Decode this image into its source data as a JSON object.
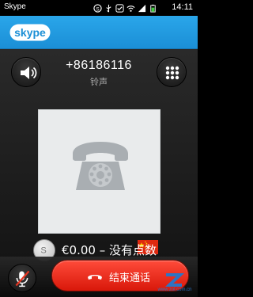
{
  "status_bar": {
    "app_name": "Skype",
    "time": "14:11",
    "icons": [
      "skype-icon",
      "usb-icon",
      "check-icon",
      "wifi-icon",
      "signal-icon",
      "battery-icon"
    ]
  },
  "header": {
    "logo_text": "skype"
  },
  "call": {
    "phone_number": "+86186116",
    "status": "铃声",
    "country_flag": "china-flag"
  },
  "credit": {
    "text": "€0.00 – 没有点数"
  },
  "actions": {
    "end_call_label": "结束通话"
  },
  "watermark": {
    "text": "www.zol.com.cn"
  },
  "colors": {
    "header_blue": "#1b8fd6",
    "end_call_red": "#e0200f",
    "background": "#1b1b1b"
  }
}
